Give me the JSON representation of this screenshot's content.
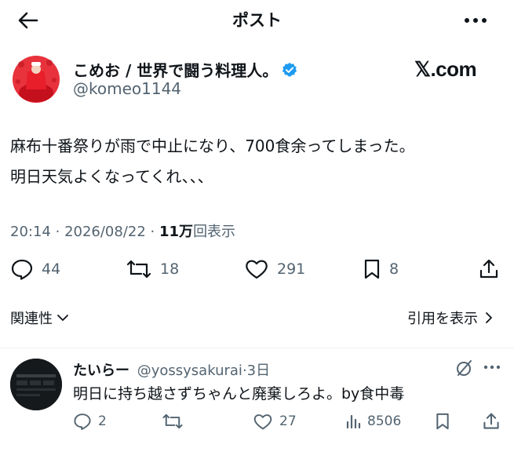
{
  "header": {
    "title": "ポスト"
  },
  "author": {
    "name": "こめお / 世界で闘う料理人。",
    "handle": "@komeo1144"
  },
  "brand": "𝕏.com",
  "post": {
    "lines": [
      "麻布十番祭りが雨で中止になり、700食余ってしまった。",
      "明日天気よくなってくれ、、、"
    ],
    "time": "20:14",
    "date": "2026/08/22",
    "views": "11万",
    "views_label": "回表示"
  },
  "stats": {
    "replies": "44",
    "reposts": "18",
    "likes": "291",
    "bookmarks": "8"
  },
  "links": {
    "related": "関連性",
    "quotes": "引用を表示"
  },
  "reply": {
    "name": "たいらー",
    "handle": "@yossysakurai",
    "age": "3日",
    "text": "明日に持ち越さずちゃんと廃棄しろよ。by食中毒",
    "stats": {
      "replies": "2",
      "reposts": "",
      "likes": "27",
      "views": "8506"
    }
  },
  "colors": {
    "text": "#0f1419",
    "muted": "#536471",
    "verified": "#1d9bf0",
    "avatar_bg": "#d9202a"
  },
  "icons": [
    "back-arrow-icon",
    "more-icon",
    "verified-icon",
    "reply-icon",
    "repost-icon",
    "like-icon",
    "bookmark-icon",
    "share-icon",
    "chevron-down-icon",
    "chevron-right-icon",
    "grok-icon",
    "views-icon"
  ]
}
